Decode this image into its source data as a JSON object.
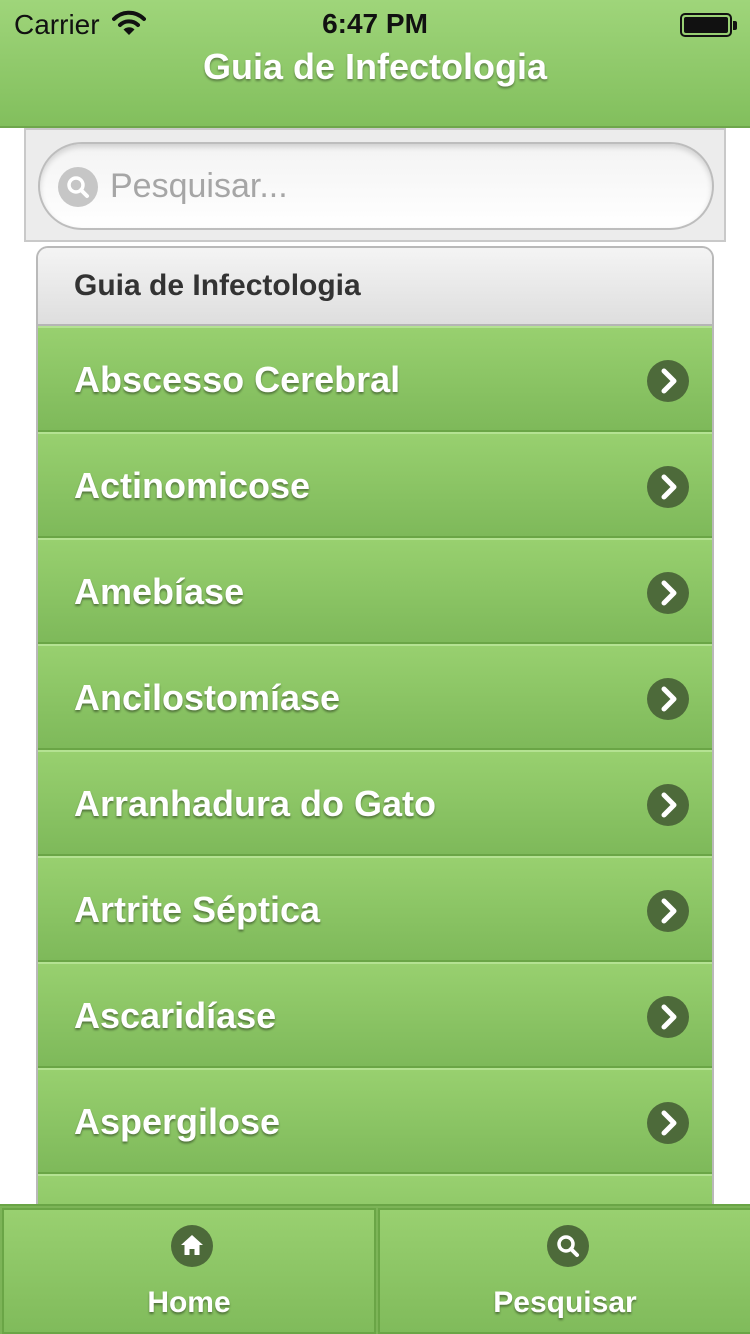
{
  "status_bar": {
    "carrier": "Carrier",
    "time": "6:47 PM"
  },
  "header": {
    "title": "Guia de Infectologia"
  },
  "search": {
    "placeholder": "Pesquisar...",
    "value": "",
    "icon": "search-icon"
  },
  "list": {
    "divider": "Guia de Infectologia",
    "items": [
      {
        "label": "Abscesso Cerebral"
      },
      {
        "label": "Actinomicose"
      },
      {
        "label": "Amebíase"
      },
      {
        "label": "Ancilostomíase"
      },
      {
        "label": "Arranhadura do Gato"
      },
      {
        "label": "Artrite Séptica"
      },
      {
        "label": "Ascaridíase"
      },
      {
        "label": "Aspergilose"
      }
    ],
    "item_icon": "chevron-right-icon"
  },
  "tab_bar": {
    "home_label": "Home",
    "home_icon": "home-icon",
    "search_label": "Pesquisar",
    "search_icon": "search-icon"
  },
  "colors": {
    "accent_green": "#8cc866",
    "icon_dark": "#4d6a3a"
  }
}
